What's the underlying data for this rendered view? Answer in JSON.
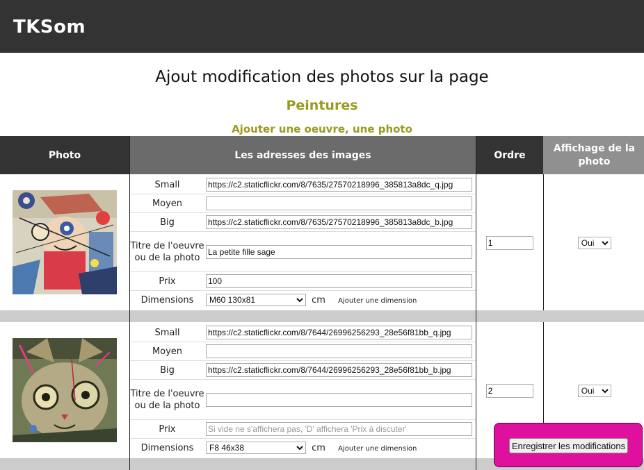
{
  "header": {
    "brand": "TKSom"
  },
  "page": {
    "title": "Ajout modification des photos sur la page",
    "subtitle": "Peintures",
    "add_link": "Ajouter une oeuvre, une photo"
  },
  "table": {
    "headers": {
      "photo": "Photo",
      "addresses": "Les adresses des images",
      "order": "Ordre",
      "display": "Affichage de la photo"
    },
    "labels": {
      "small": "Small",
      "medium": "Moyen",
      "big": "Big",
      "title": "Titre de l'oeuvre ou de la photo",
      "price": "Prix",
      "dimensions": "Dimensions",
      "unit": "cm",
      "add_dimension": "Ajouter une dimension"
    },
    "price_placeholder": "Si vide ne s'affichera pas, 'D' affichera 'Prix à discuter'",
    "rows": [
      {
        "small": "https://c2.staticflickr.com/8/7635/27570218996_385813a8dc_q.jpg",
        "medium": "",
        "big": "https://c2.staticflickr.com/8/7635/27570218996_385813a8dc_b.jpg",
        "title": "La petite fille sage",
        "price": "100",
        "dimension": "M60 130x81",
        "order": "1",
        "display": "Oui"
      },
      {
        "small": "https://c2.staticflickr.com/8/7644/26996256293_28e56f81bb_q.jpg",
        "medium": "",
        "big": "https://c2.staticflickr.com/8/7644/26996256293_28e56f81bb_b.jpg",
        "title": "",
        "price": "",
        "dimension": "F8 46x38",
        "order": "2",
        "display": "Oui"
      }
    ]
  },
  "save_button": "Enregistrer les modifications",
  "colors": {
    "accent": "#9a9a22",
    "save_box": "#e0109e",
    "header_bg": "#333333"
  }
}
